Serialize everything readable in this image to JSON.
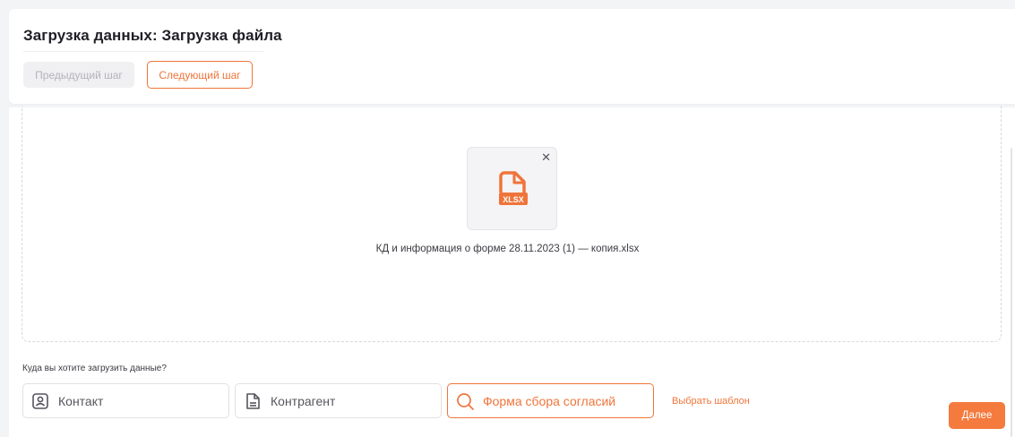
{
  "header": {
    "title": "Загрузка данных: Загрузка файла",
    "prev_label": "Предыдущий шаг",
    "next_label": "Следующий шаг"
  },
  "upload": {
    "file_type": "XLSX",
    "file_name": "КД и информация о форме 28.11.2023 (1) — копия.xlsx",
    "remove_icon": "close-icon"
  },
  "destination": {
    "question": "Куда вы хотите загрузить данные?",
    "options": [
      {
        "label": "Контакт",
        "icon": "contact-icon",
        "selected": false
      },
      {
        "label": "Контрагент",
        "icon": "document-icon",
        "selected": false
      },
      {
        "label": "Форма сбора согласий",
        "icon": "search-icon",
        "selected": true
      }
    ],
    "template_link": "Выбрать шаблон",
    "next_label": "Далее"
  },
  "colors": {
    "accent": "#f0743a",
    "disabled_bg": "#f0f0f2",
    "disabled_text": "#b3b3ba"
  }
}
